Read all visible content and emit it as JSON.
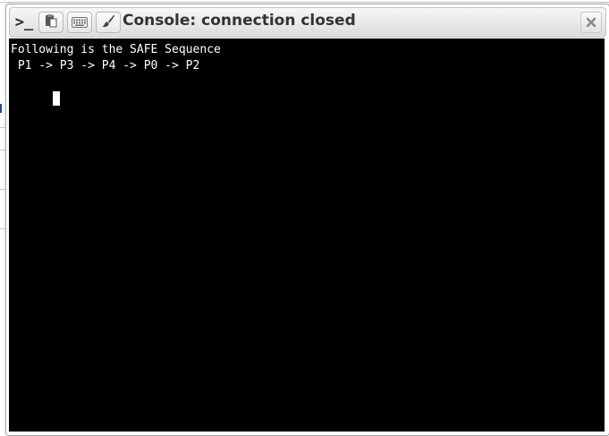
{
  "window": {
    "title": "Console: connection closed",
    "prompt_glyph": ">_"
  },
  "toolbar": {
    "icons": [
      "prompt-icon",
      "paste-icon",
      "keyboard-icon",
      "brush-icon"
    ],
    "close_icon": "close-icon"
  },
  "terminal": {
    "lines": [
      "Following is the SAFE Sequence",
      " P1 -> P3 -> P4 -> P0 -> P2"
    ],
    "background": "#000000",
    "foreground": "#ffffff"
  }
}
